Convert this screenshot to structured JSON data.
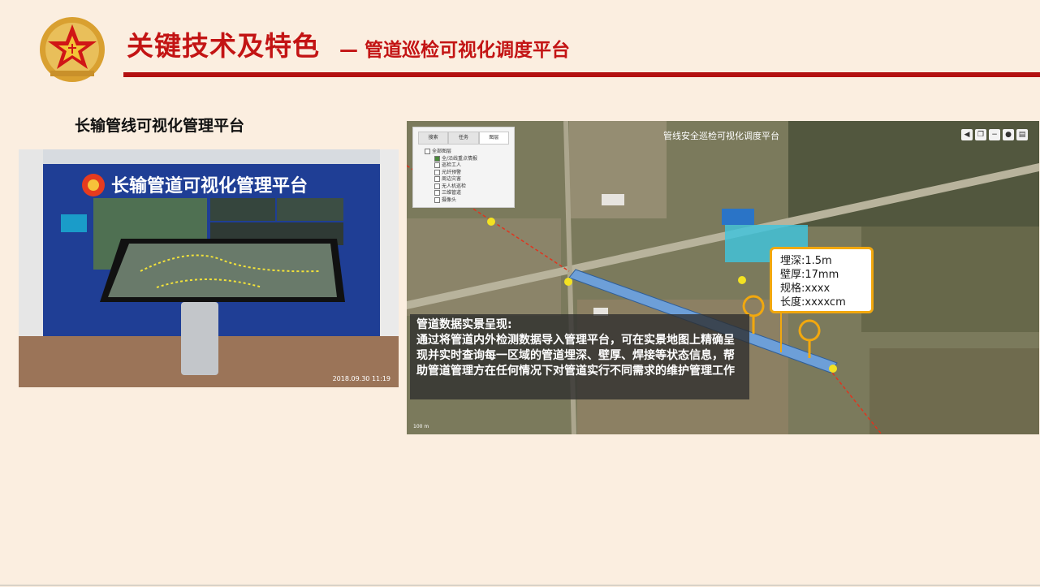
{
  "header": {
    "title": "关键技术及特色",
    "subtitle": "— 管道巡检可视化调度平台",
    "accent_color": "#c31414"
  },
  "left": {
    "heading": "长输管线可视化管理平台",
    "photo": {
      "wall_sign": "长输管道可视化管理平台",
      "timestamp": "2018.09.30 11:19"
    }
  },
  "map": {
    "title": "管线安全巡检可视化调度平台",
    "toolbar": [
      "back-icon",
      "layers-icon",
      "minus-icon",
      "record-icon",
      "delete-icon"
    ],
    "layer_panel": {
      "tabs": [
        "搜索",
        "任务",
        "图层"
      ],
      "active_tab": 2,
      "tree": [
        {
          "label": "全部图层",
          "level": 0
        },
        {
          "label": "全/沿线重点情报",
          "level": 1,
          "checked": true
        },
        {
          "label": "巡检工人",
          "level": 1,
          "checked": false
        },
        {
          "label": "光纤预警",
          "level": 1,
          "checked": false
        },
        {
          "label": "周边灾害",
          "level": 1,
          "checked": false
        },
        {
          "label": "无人机巡检",
          "level": 1,
          "checked": false
        },
        {
          "label": "三维管道",
          "level": 1,
          "checked": false
        },
        {
          "label": "摄像头",
          "level": 1,
          "checked": false
        }
      ]
    },
    "callout": {
      "lines": [
        "埋深:1.5m",
        "壁厚:17mm",
        "规格:xxxx",
        "长度:xxxxcm"
      ]
    },
    "data_box": {
      "title": "管道数据实景呈现:",
      "body": "通过将管道内外检测数据导入管理平台，可在实景地图上精确呈现并实时查询每一区域的管道埋深、壁厚、焊接等状态信息，帮助管道管理方在任何情况下对管道实行不同需求的维护管理工作"
    },
    "scale": "100 m"
  }
}
